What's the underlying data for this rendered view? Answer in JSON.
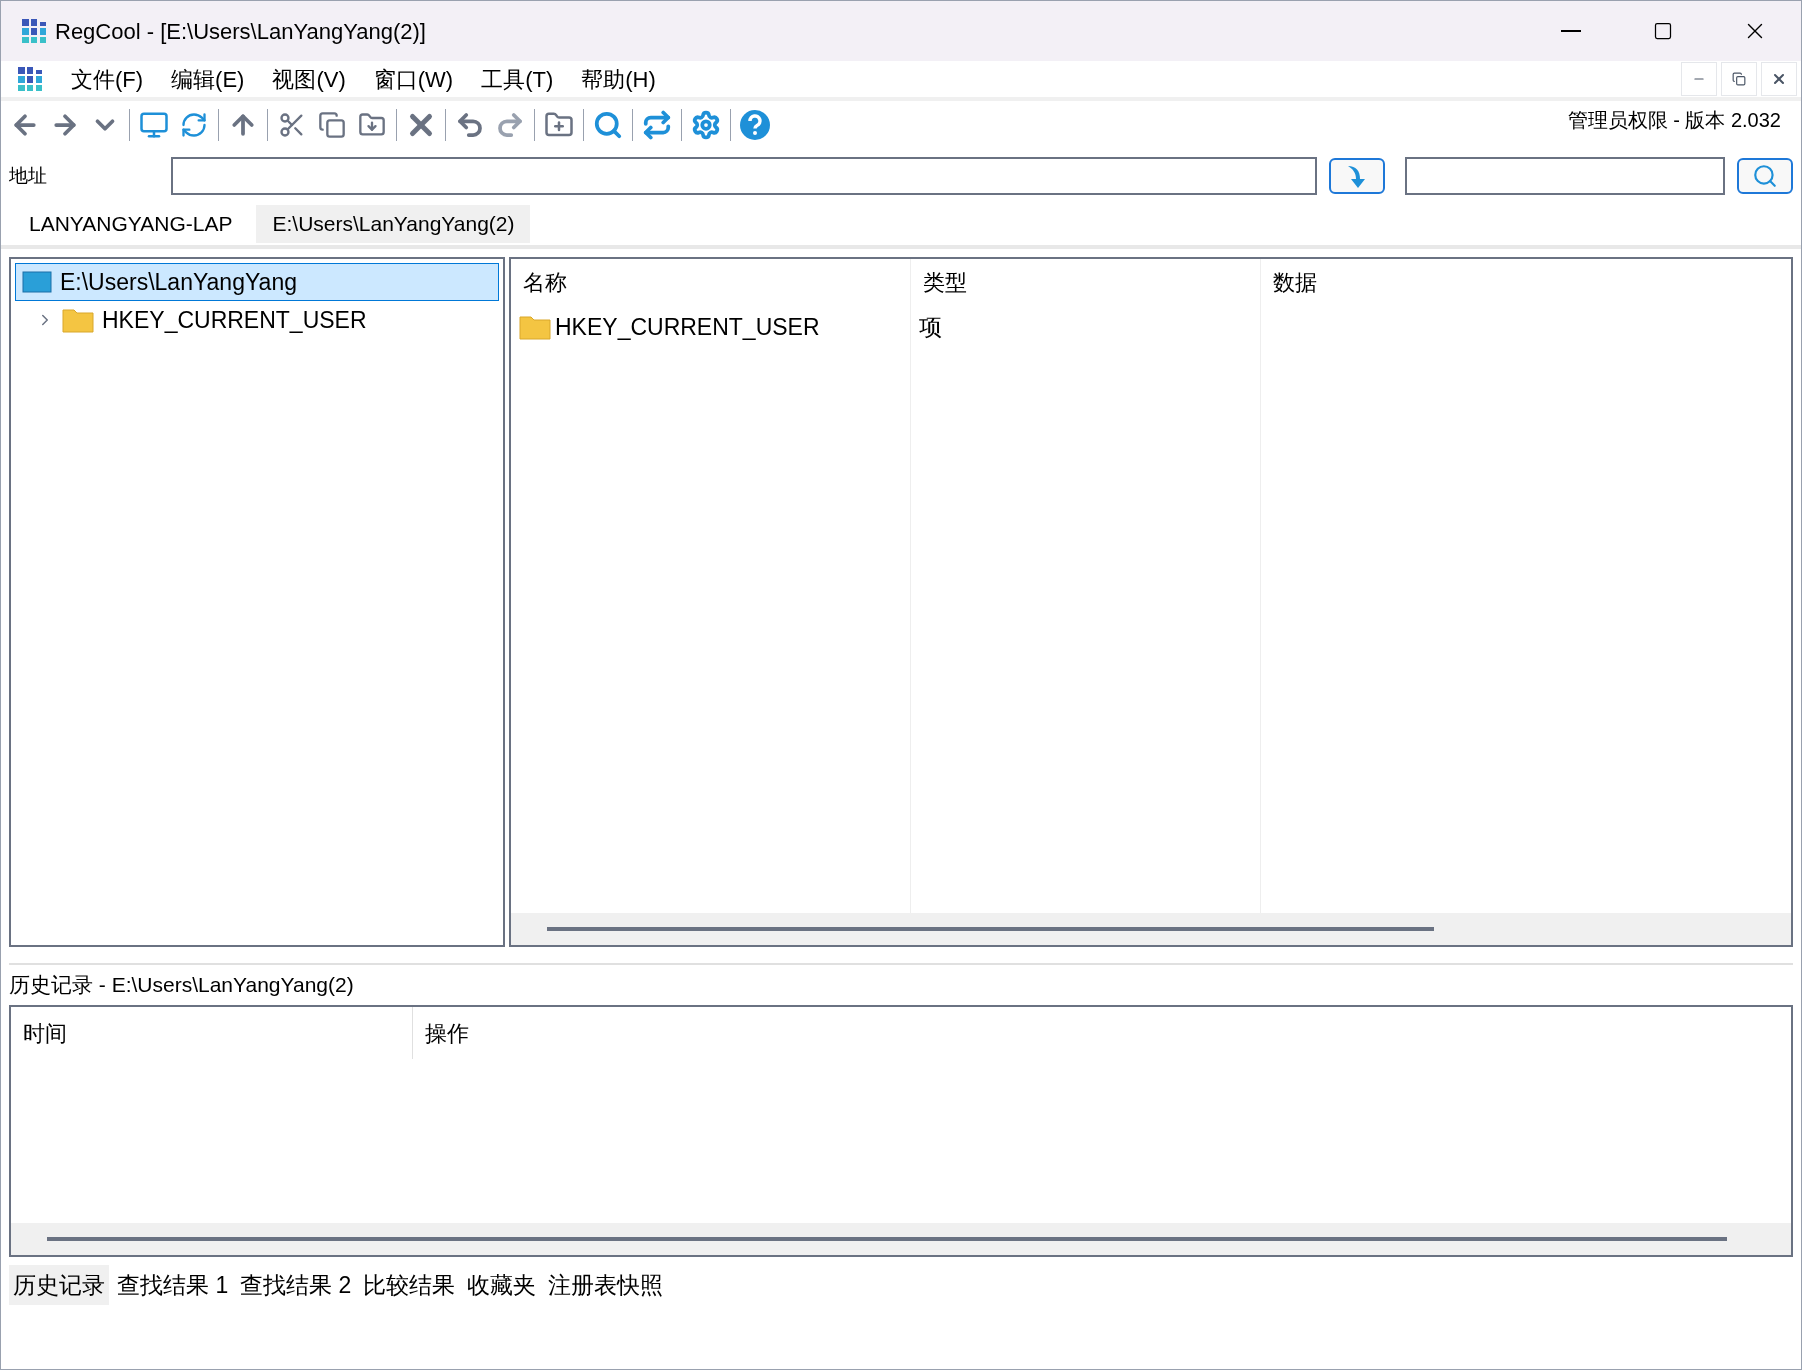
{
  "window": {
    "title": "RegCool - [E:\\Users\\LanYangYang(2)]"
  },
  "menu": {
    "items": [
      "文件(F)",
      "编辑(E)",
      "视图(V)",
      "窗口(W)",
      "工具(T)",
      "帮助(H)"
    ]
  },
  "toolbar": {
    "status": "管理员权限 - 版本 2.032"
  },
  "address": {
    "label": "地址"
  },
  "tabs": [
    {
      "label": "LANYANGYANG-LAP",
      "selected": false
    },
    {
      "label": "E:\\Users\\LanYangYang(2)",
      "selected": true
    }
  ],
  "tree": [
    {
      "label": "E:\\Users\\LanYangYang",
      "kind": "file",
      "selected": true,
      "children": [
        {
          "label": "HKEY_CURRENT_USER",
          "kind": "folder",
          "selected": false,
          "expanded": false
        }
      ]
    }
  ],
  "list": {
    "columns": [
      "名称",
      "类型",
      "数据"
    ],
    "rows": [
      {
        "name": "HKEY_CURRENT_USER",
        "type": "项"
      }
    ]
  },
  "history": {
    "title": "历史记录 - E:\\Users\\LanYangYang(2)",
    "columns": [
      "时间",
      "操作"
    ]
  },
  "bottom_tabs": [
    {
      "label": "历史记录",
      "selected": true
    },
    {
      "label": "查找结果 1",
      "selected": false
    },
    {
      "label": "查找结果 2",
      "selected": false
    },
    {
      "label": "比较结果",
      "selected": false
    },
    {
      "label": "收藏夹",
      "selected": false
    },
    {
      "label": "注册表快照",
      "selected": false
    }
  ]
}
